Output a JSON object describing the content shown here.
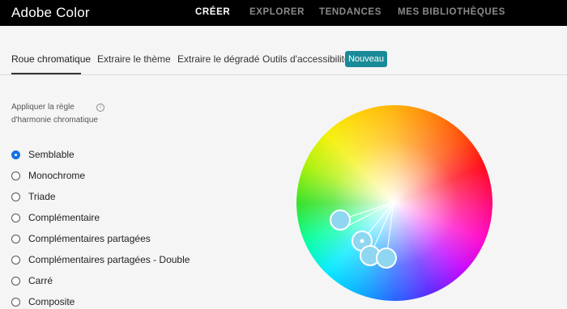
{
  "app": {
    "title": "Adobe Color"
  },
  "nav": [
    "CRÉER",
    "EXPLORER",
    "TENDANCES",
    "MES BIBLIOTHÈQUES"
  ],
  "tabs": [
    "Roue chromatique",
    "Extraire le thème",
    "Extraire le dégradé",
    "Outils d'accessibilité"
  ],
  "badge": "Nouveau",
  "panel": {
    "rule_label": "Appliquer la règle d'harmonie chromatique",
    "info_icon": "info-icon",
    "options": [
      {
        "label": "Semblable",
        "checked": true
      },
      {
        "label": "Monochrome",
        "checked": false
      },
      {
        "label": "Triade",
        "checked": false
      },
      {
        "label": "Complémentaire",
        "checked": false
      },
      {
        "label": "Complémentaires partagées",
        "checked": false
      },
      {
        "label": "Complémentaires partagées - Double",
        "checked": false
      },
      {
        "label": "Carré",
        "checked": false
      },
      {
        "label": "Composite",
        "checked": false
      }
    ]
  },
  "colors": {
    "accent": "#1473e6",
    "badge_bg": "#1b8a97",
    "handle_fill": "#8fd6f0"
  }
}
